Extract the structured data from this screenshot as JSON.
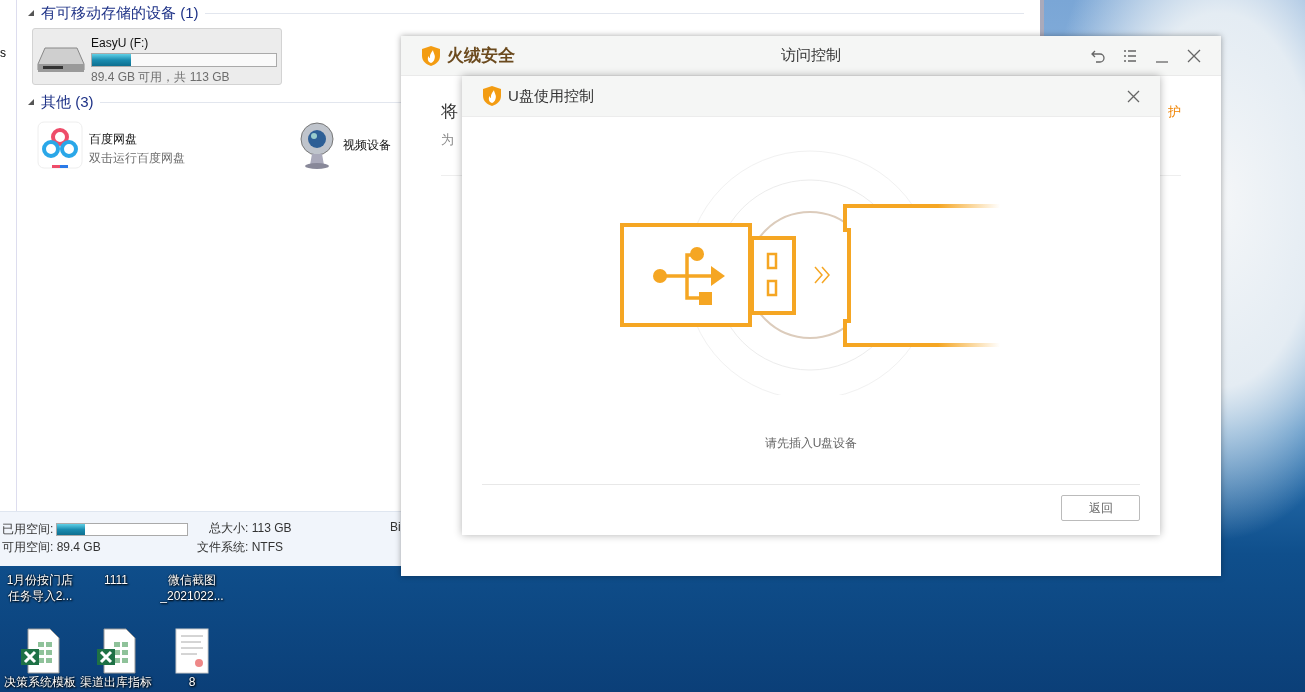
{
  "explorer": {
    "nav_fragment": "s",
    "sections": [
      {
        "title": "有可移动存储的设备 (1)",
        "expanded": true,
        "items": [
          {
            "kind": "drive",
            "name": "EasyU (F:)",
            "level": 0.21,
            "detail": "89.4 GB 可用，共 113 GB",
            "selected": true
          }
        ]
      },
      {
        "title": "其他 (3)",
        "expanded": true,
        "items": [
          {
            "kind": "cloud_app",
            "name": "百度网盘",
            "detail": "双击运行百度网盘",
            "selected": false
          },
          {
            "kind": "camera",
            "name": "视频设备",
            "selected": false
          }
        ]
      }
    ],
    "details": {
      "used": {
        "label": "已用空间:",
        "level": 0.21
      },
      "total": "总大小: 113 GB",
      "cut_field": "Bi",
      "free": "可用空间: 89.4 GB",
      "filesystem": "文件系统: NTFS"
    }
  },
  "access_window": {
    "brand": "火绒安全",
    "title": "访问控制",
    "heading_fragment": "将",
    "description_fragment": "为",
    "action_fragment": "护"
  },
  "dialog": {
    "title": "U盘使用控制",
    "message": "请先插入U盘设备",
    "buttons": [
      "返回"
    ]
  },
  "desktop_icons": [
    {
      "kind": "covered",
      "lines": [
        "1月份按门店",
        "任务导入2..."
      ]
    },
    {
      "kind": "covered",
      "lines": [
        "1111"
      ]
    },
    {
      "kind": "covered",
      "lines": [
        "微信截图",
        "_2021022..."
      ]
    },
    {
      "kind": "spreadsheet",
      "lines": [
        "决策系统模板"
      ]
    },
    {
      "kind": "spreadsheet",
      "lines": [
        "渠道出库指标"
      ]
    },
    {
      "kind": "document",
      "lines": [
        "8"
      ]
    }
  ]
}
